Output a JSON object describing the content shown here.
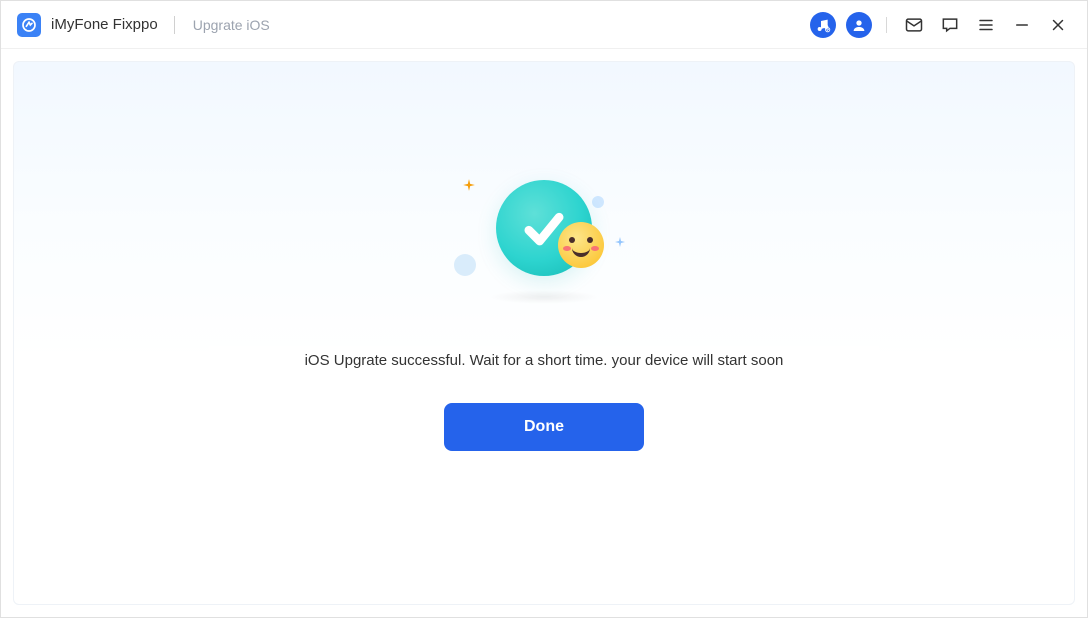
{
  "header": {
    "app_name": "iMyFone Fixppo",
    "breadcrumb": "Upgrate iOS"
  },
  "main": {
    "status_message": "iOS Upgrate successful. Wait for a short time. your device will start soon",
    "done_label": "Done"
  },
  "icons": {
    "logo": "app-logo",
    "music": "music-icon",
    "account": "account-icon",
    "mail": "mail-icon",
    "chat": "chat-icon",
    "menu": "menu-icon",
    "minimize": "minimize-icon",
    "close": "close-icon",
    "check": "check-icon",
    "smiley": "smiley-icon"
  }
}
